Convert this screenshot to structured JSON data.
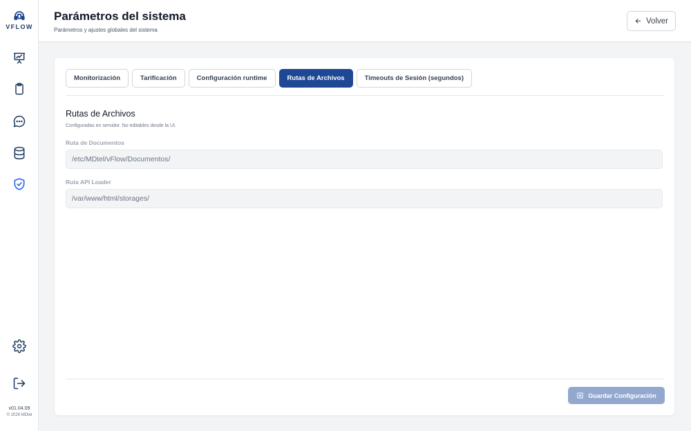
{
  "sidebar": {
    "logo_text": "VFLOW",
    "nav": [
      {
        "icon": "presentation-chart-icon"
      },
      {
        "icon": "clipboard-icon"
      },
      {
        "icon": "chat-bubble-icon"
      },
      {
        "icon": "database-icon"
      },
      {
        "icon": "shield-check-icon",
        "active": true
      }
    ],
    "settings_icon": "gear-icon",
    "logout_icon": "logout-icon",
    "version": "v01.04.09",
    "copyright": "© 2026 MDtel"
  },
  "header": {
    "title": "Parámetros del sistema",
    "subtitle": "Parámetros y ajustes globales del sistema",
    "back_label": "Volver"
  },
  "tabs": [
    {
      "label": "Monitorización",
      "active": false
    },
    {
      "label": "Tarificación",
      "active": false
    },
    {
      "label": "Configuración runtime",
      "active": false
    },
    {
      "label": "Rutas de Archivos",
      "active": true
    },
    {
      "label": "Timeouts de Sesión (segundos)",
      "active": false
    }
  ],
  "section": {
    "title": "Rutas de Archivos",
    "subtitle": "Configuradas en servidor. No editables desde la UI."
  },
  "fields": {
    "documents": {
      "label": "Ruta de Documentos",
      "value": "/etc/MDtel/vFlow/Documentos/"
    },
    "api_loader": {
      "label": "Ruta API Loader",
      "value": "/var/www/html/storages/"
    }
  },
  "save_button_label": "Guardar Configuración",
  "colors": {
    "accent": "#1e4794",
    "sidebar_icon": "#1e3a5f",
    "active_icon": "#2563eb",
    "save_disabled": "#93a8cf"
  }
}
